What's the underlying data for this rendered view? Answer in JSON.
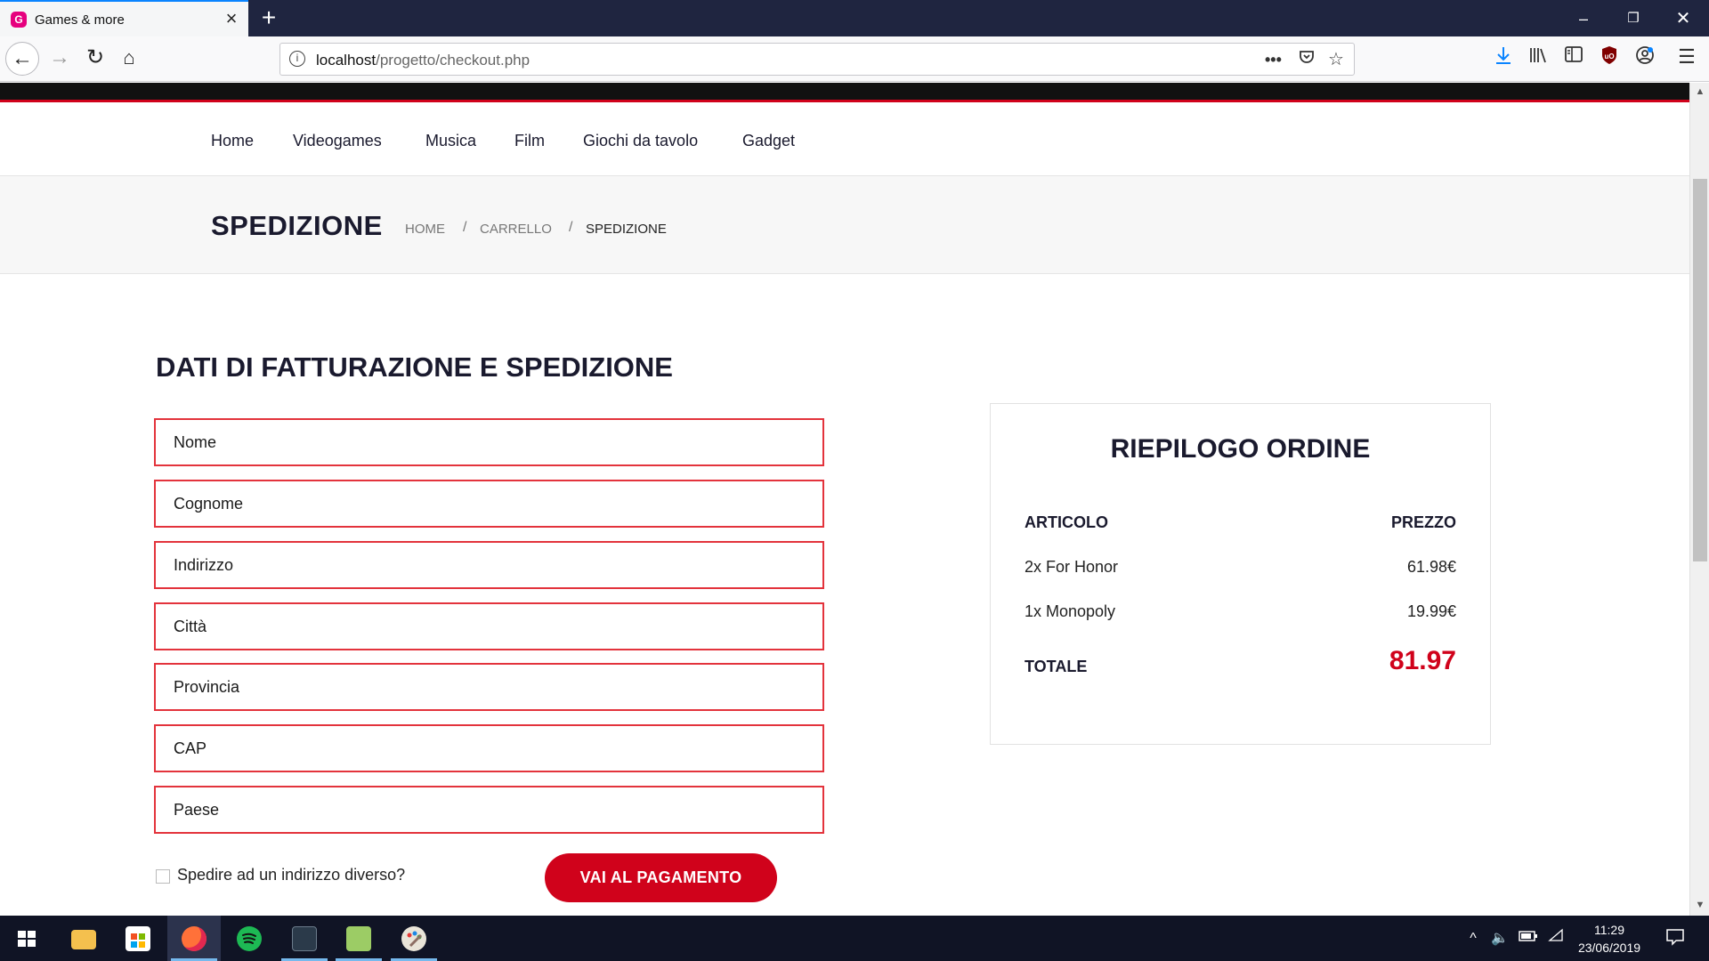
{
  "browser": {
    "tab_title": "Games & more",
    "url_host": "localhost",
    "url_path": "/progetto/checkout.php"
  },
  "nav": {
    "items": [
      "Home",
      "Videogames",
      "Musica",
      "Film",
      "Giochi da tavolo",
      "Gadget"
    ]
  },
  "page_header": {
    "title": "SPEDIZIONE",
    "breadcrumb": [
      "HOME",
      "CARRELLO",
      "SPEDIZIONE"
    ],
    "separator": "/"
  },
  "form": {
    "title": "DATI DI FATTURAZIONE E SPEDIZIONE",
    "fields": [
      {
        "placeholder": "Nome",
        "value": ""
      },
      {
        "placeholder": "Cognome",
        "value": ""
      },
      {
        "placeholder": "Indirizzo",
        "value": ""
      },
      {
        "placeholder": "Città",
        "value": ""
      },
      {
        "placeholder": "Provincia",
        "value": ""
      },
      {
        "placeholder": "CAP",
        "value": ""
      },
      {
        "placeholder": "Paese",
        "value": ""
      }
    ],
    "checkbox_label": "Spedire ad un indirizzo diverso?",
    "checkbox_checked": false,
    "submit_label": "VAI AL PAGAMENTO"
  },
  "summary": {
    "title": "RIEPILOGO ORDINE",
    "col_item": "ARTICOLO",
    "col_price": "PREZZO",
    "rows": [
      {
        "item": "2x For Honor",
        "price": "61.98€"
      },
      {
        "item": "1x Monopoly",
        "price": "19.99€"
      }
    ],
    "total_label": "TOTALE",
    "total_value": "81.97"
  },
  "taskbar": {
    "time": "11:29",
    "date": "23/06/2019"
  },
  "colors": {
    "accent": "#d0021b",
    "field_border": "#e3333c",
    "heading": "#1a1a2e",
    "tabbar": "#1f2540",
    "taskbar": "#101425"
  },
  "icons": {
    "tab": "games-favicon",
    "toolbar": [
      "back-arrow-icon",
      "forward-arrow-icon",
      "reload-icon",
      "home-icon"
    ],
    "urlbar": [
      "info-icon",
      "more-dots-icon",
      "pocket-icon",
      "bookmark-star-icon"
    ],
    "right_toolbar": [
      "download-icon",
      "library-icon",
      "sidebar-icon",
      "ublock-icon",
      "account-icon",
      "menu-icon"
    ]
  }
}
